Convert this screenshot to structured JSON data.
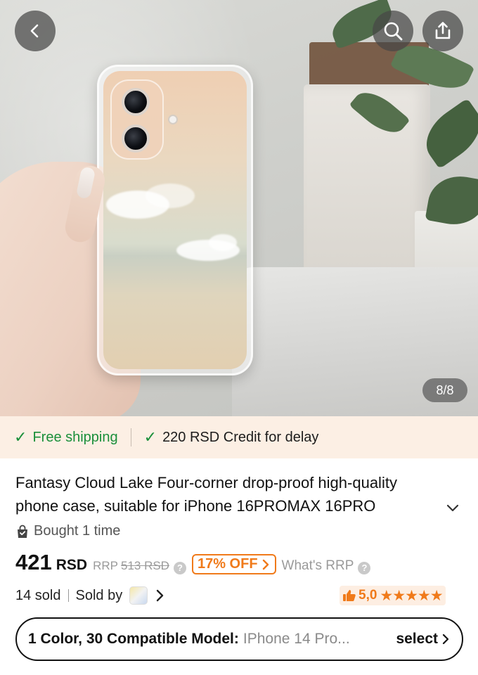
{
  "gallery": {
    "counter": "8/8",
    "icons": {
      "back": "chevron-left-icon",
      "search": "search-icon",
      "share": "share-icon"
    }
  },
  "shipping": {
    "free_shipping": "Free shipping",
    "credit": "220 RSD Credit for delay",
    "accent_color": "#1a8f3a"
  },
  "product": {
    "title": "Fantasy Cloud Lake Four-corner drop-proof high-quality phone case, suitable for iPhone 16PROMAX 16PRO",
    "bought": "Bought 1 time",
    "price": "421",
    "currency": "RSD",
    "rrp_label": "RRP",
    "rrp_value": "513 RSD",
    "discount": "17% OFF",
    "whats_rrp": "What's RRP",
    "sold": "14 sold",
    "sold_by": "Sold by",
    "rating": "5,0",
    "stars": "★★★★★",
    "accent_color": "#f07a1a"
  },
  "variant": {
    "label": "1 Color, 30 Compatible Model:",
    "value": "IPhone 14 Pro...",
    "select": "select"
  }
}
